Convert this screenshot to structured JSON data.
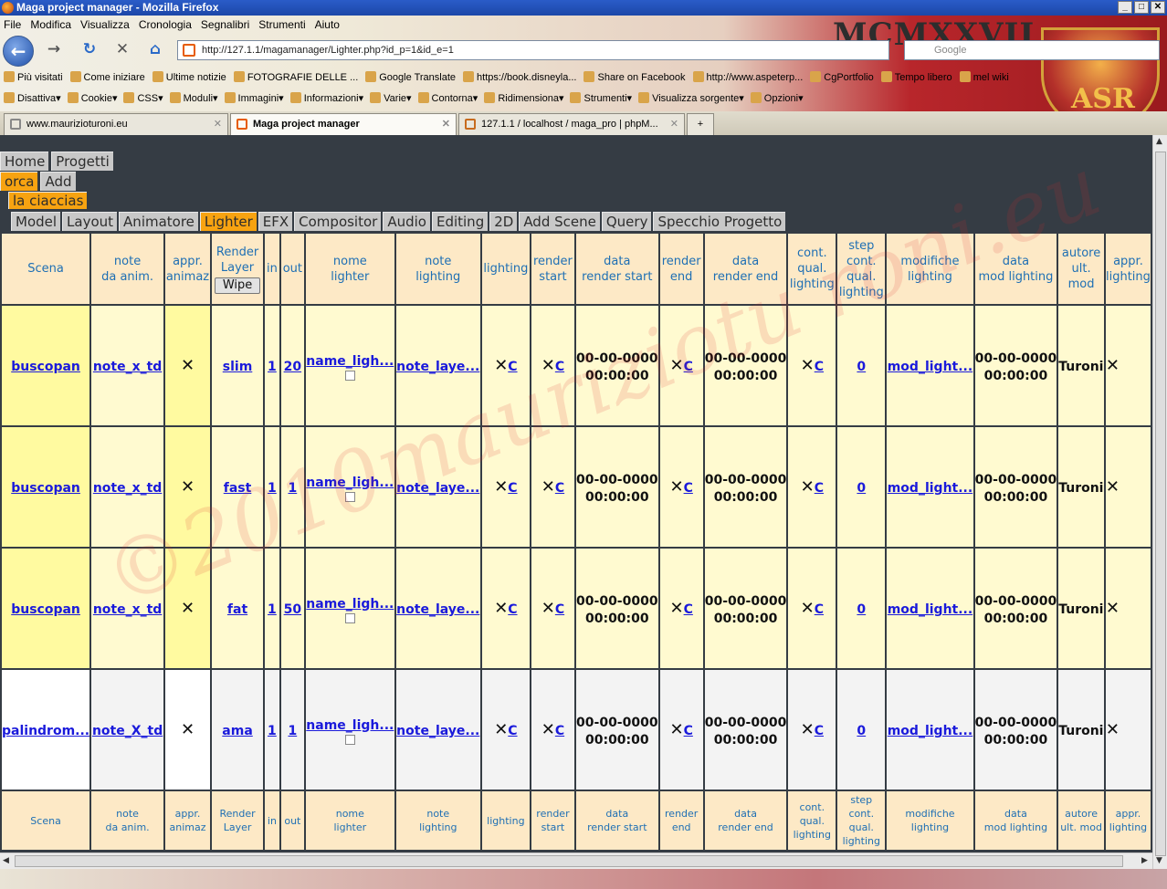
{
  "window": {
    "title": "Maga project manager - Mozilla Firefox",
    "btns": [
      "_",
      "□",
      "✕"
    ]
  },
  "menu": [
    "File",
    "Modifica",
    "Visualizza",
    "Cronologia",
    "Segnalibri",
    "Strumenti",
    "Aiuto"
  ],
  "url": "http://127.1.1/magamanager/Lighter.php?id_p=1&id_e=1",
  "search_placeholder": "Google",
  "logo_text": "MCMXXVII",
  "logo_badge": "ASR",
  "bookmarks": [
    "Più visitati",
    "Come iniziare",
    "Ultime notizie",
    "FOTOGRAFIE DELLE ...",
    "Google Translate",
    "https://book.disneyla...",
    "Share on Facebook",
    "http://www.aspeterp...",
    "CgPortfolio",
    "Tempo libero",
    "mel wiki"
  ],
  "devtools": [
    "Disattiva▾",
    "Cookie▾",
    "CSS▾",
    "Moduli▾",
    "Immagini▾",
    "Informazioni▾",
    "Varie▾",
    "Contorna▾",
    "Ridimensiona▾",
    "Strumenti▾",
    "Visualizza sorgente▾",
    "Opzioni▾"
  ],
  "tabs": [
    {
      "label": "www.maurizioturoni.eu",
      "close": "✕"
    },
    {
      "label": "Maga project manager",
      "close": "✕"
    },
    {
      "label": "127.1.1 / localhost / maga_pro | phpM...",
      "close": "✕"
    }
  ],
  "new_tab": "+",
  "nav": {
    "home": "Home",
    "projects": "Progetti",
    "project": "orca",
    "add": "Add",
    "episode": "la ciaccias",
    "departments": [
      "Model",
      "Layout",
      "Animatore",
      "Lighter",
      "EFX",
      "Compositor",
      "Audio",
      "Editing",
      "2D",
      "Add Scene",
      "Query",
      "Specchio Progetto"
    ],
    "active_department": "Lighter"
  },
  "table": {
    "headers": [
      [
        "Scena"
      ],
      [
        "note",
        "da anim."
      ],
      [
        "appr.",
        "animaz"
      ],
      [
        "Render",
        "Layer"
      ],
      [
        "in"
      ],
      [
        "out"
      ],
      [
        "nome",
        "lighter"
      ],
      [
        "note",
        "lighting"
      ],
      [
        "lighting"
      ],
      [
        "render",
        "start"
      ],
      [
        "data",
        "render start"
      ],
      [
        "render",
        "end"
      ],
      [
        "data",
        "render end"
      ],
      [
        "cont.",
        "qual.",
        "lighting"
      ],
      [
        "step",
        "cont.",
        "qual.",
        "lighting"
      ],
      [
        "modifiche",
        "lighting"
      ],
      [
        "data",
        "mod lighting"
      ],
      [
        "autore",
        "ult.",
        "mod"
      ],
      [
        "appr.",
        "lighting"
      ]
    ],
    "footers": [
      [
        "Scena"
      ],
      [
        "note",
        "da anim."
      ],
      [
        "appr.",
        "animaz"
      ],
      [
        "Render",
        "Layer"
      ],
      [
        "in"
      ],
      [
        "out"
      ],
      [
        "nome",
        "lighter"
      ],
      [
        "note",
        "lighting"
      ],
      [
        "lighting"
      ],
      [
        "render",
        "start"
      ],
      [
        "data",
        "render start"
      ],
      [
        "render",
        "end"
      ],
      [
        "data",
        "render end"
      ],
      [
        "cont.",
        "qual.",
        "lighting"
      ],
      [
        "step",
        "cont.",
        "qual.",
        "lighting"
      ],
      [
        "modifiche",
        "lighting"
      ],
      [
        "data",
        "mod lighting"
      ],
      [
        "autore",
        "ult. mod"
      ],
      [
        "appr.",
        "lighting"
      ]
    ],
    "wipe_label": "Wipe",
    "cross": "✕",
    "c_link": "C",
    "date": [
      "00-00-0000",
      "00:00:00"
    ],
    "rows": [
      {
        "scena": "buscopan",
        "note": "note_x_td",
        "layer": "slim",
        "in": "1",
        "out": "20",
        "nome": "name_ligh...",
        "note_l": "note_laye...",
        "step": "0",
        "mod": "mod_light...",
        "autore": "Turoni",
        "tone": "yellow"
      },
      {
        "scena": "buscopan",
        "note": "note_x_td",
        "layer": "fast",
        "in": "1",
        "out": "1",
        "nome": "name_ligh...",
        "note_l": "note_laye...",
        "step": "0",
        "mod": "mod_light...",
        "autore": "Turoni",
        "tone": "yellow"
      },
      {
        "scena": "buscopan",
        "note": "note_x_td",
        "layer": "fat",
        "in": "1",
        "out": "50",
        "nome": "name_ligh...",
        "note_l": "note_laye...",
        "step": "0",
        "mod": "mod_light...",
        "autore": "Turoni",
        "tone": "yellow"
      },
      {
        "scena": "palindrom...",
        "note": "note_X_td",
        "layer": "ama",
        "in": "1",
        "out": "1",
        "nome": "name_ligh...",
        "note_l": "note_laye...",
        "step": "0",
        "mod": "mod_light...",
        "autore": "Turoni",
        "tone": "gray"
      }
    ]
  },
  "watermark": "©2010mauriziotu roni.eu",
  "colors": {
    "accent": "#f7a311",
    "header_bg": "#fde9c6",
    "header_text": "#1e6fb4",
    "link": "#1a1adb",
    "page_bg": "#353c44"
  }
}
